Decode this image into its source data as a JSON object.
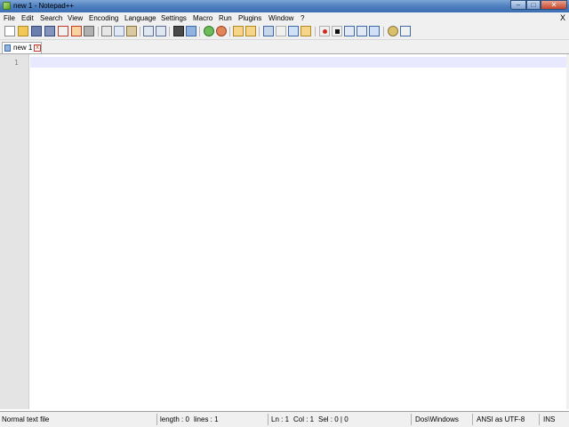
{
  "window": {
    "title": "new  1 - Notepad++",
    "min_glyph": "–",
    "max_glyph": "□",
    "close_glyph": "✕"
  },
  "menu": {
    "items": [
      "File",
      "Edit",
      "Search",
      "View",
      "Encoding",
      "Language",
      "Settings",
      "Macro",
      "Run",
      "Plugins",
      "Window",
      "?"
    ],
    "close": "X"
  },
  "toolbar": {
    "icons": [
      "new-file-icon",
      "open-file-icon",
      "save-icon",
      "save-all-icon",
      "close-icon",
      "close-all-icon",
      "print-icon",
      "cut-icon",
      "copy-icon",
      "paste-icon",
      "undo-icon",
      "redo-icon",
      "find-icon",
      "replace-icon",
      "zoom-in-icon",
      "zoom-out-icon",
      "sync-vertical-icon",
      "sync-horizontal-icon",
      "word-wrap-icon",
      "show-all-chars-icon",
      "indent-guide-icon",
      "user-language-icon",
      "record-macro-icon",
      "stop-record-icon",
      "play-macro-icon",
      "run-macro-multiple-icon",
      "save-macro-icon",
      "monitoring-icon",
      "spell-check-icon"
    ]
  },
  "tabs": [
    {
      "label": "new  1",
      "close_glyph": "x"
    }
  ],
  "editor": {
    "line_numbers": [
      "1"
    ]
  },
  "status": {
    "file_type": "Normal text file",
    "length": "length : 0",
    "lines": "lines : 1",
    "ln": "Ln : 1",
    "col": "Col : 1",
    "sel": "Sel : 0 | 0",
    "eol": "Dos\\Windows",
    "encoding": "ANSI as UTF-8",
    "mode": "INS"
  },
  "colors": {
    "current_line": "#e8e8ff",
    "gutter": "#e4e4e4",
    "title_bar": "#4f7fbf"
  }
}
